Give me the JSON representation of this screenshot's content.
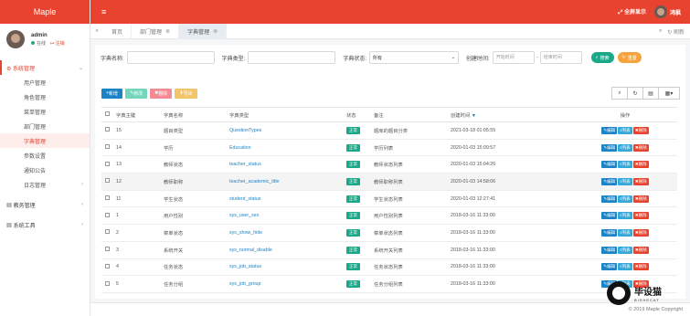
{
  "app": {
    "logo": "Maple"
  },
  "user": {
    "name": "admin",
    "status": "在线",
    "logout": "注销"
  },
  "sidebar": {
    "groups": [
      {
        "label": "系统管理",
        "items": [
          "用户管理",
          "角色管理",
          "菜单管理",
          "部门管理",
          "字典管理",
          "参数设置",
          "通知公告",
          "日志管理"
        ]
      },
      {
        "label": "教务管理"
      },
      {
        "label": "系统工具"
      }
    ]
  },
  "topbar": {
    "fullscreen": "全屏显示",
    "username": "鸿枫"
  },
  "tabs": {
    "items": [
      "首页",
      "部门管理",
      "字典管理"
    ],
    "refresh": "刷新"
  },
  "search": {
    "name_label": "字典名称:",
    "type_label": "字典类型:",
    "status_label": "字典状态:",
    "status_value": "所有",
    "time_label": "创建时间:",
    "start_placeholder": "开始时间",
    "end_placeholder": "结束时间",
    "search_btn": "搜索",
    "reset_btn": "重置"
  },
  "toolbar": {
    "add": "新增",
    "edit": "修改",
    "delete": "删除",
    "export": "导出"
  },
  "table": {
    "headers": [
      "字典主键",
      "字典名称",
      "字典类型",
      "状态",
      "备注",
      "创建时间",
      "操作"
    ],
    "rows": [
      {
        "id": "15",
        "name": "题目类型",
        "type": "QuestionTypes",
        "status": "正常",
        "remark": "题库的题目分类",
        "time": "2021-03-18 01:05:55"
      },
      {
        "id": "14",
        "name": "学历",
        "type": "Education",
        "status": "正常",
        "remark": "学历列表",
        "time": "2020-01-03 15:09:57"
      },
      {
        "id": "13",
        "name": "教师状态",
        "type": "teacher_status",
        "status": "正常",
        "remark": "教师状态列表",
        "time": "2020-01-03 15:04:26"
      },
      {
        "id": "12",
        "name": "教师职称",
        "type": "teacher_academic_title",
        "status": "正常",
        "remark": "教师职称列表",
        "time": "2020-01-03 14:58:06"
      },
      {
        "id": "11",
        "name": "学生状态",
        "type": "student_status",
        "status": "正常",
        "remark": "学生状态列表",
        "time": "2020-01-03 12:27:41"
      },
      {
        "id": "1",
        "name": "用户性别",
        "type": "sys_user_sex",
        "status": "正常",
        "remark": "用户性别列表",
        "time": "2018-03-16 11:33:00"
      },
      {
        "id": "2",
        "name": "菜单状态",
        "type": "sys_show_hide",
        "status": "正常",
        "remark": "菜单状态列表",
        "time": "2018-03-16 11:33:00"
      },
      {
        "id": "3",
        "name": "系统开关",
        "type": "sys_normal_disable",
        "status": "正常",
        "remark": "系统开关列表",
        "time": "2018-03-16 11:33:00"
      },
      {
        "id": "4",
        "name": "任务状态",
        "type": "sys_job_status",
        "status": "正常",
        "remark": "任务状态列表",
        "time": "2018-03-16 11:33:00"
      },
      {
        "id": "5",
        "name": "任务分组",
        "type": "sys_job_group",
        "status": "正常",
        "remark": "任务分组列表",
        "time": "2018-03-16 11:33:00"
      }
    ],
    "ops": {
      "edit": "编辑",
      "list": "列表",
      "del": "删除"
    }
  },
  "footer": {
    "copyright": "© 2019 Maple Copyright"
  },
  "watermark": {
    "text": "毕设猫",
    "sub": "BISHECAT"
  }
}
